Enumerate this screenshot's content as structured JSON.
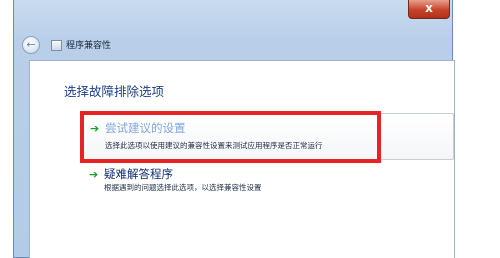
{
  "window": {
    "close_label": "x",
    "title": "程序兼容性"
  },
  "page": {
    "heading": "选择故障排除选项"
  },
  "options": [
    {
      "title": "尝试建议的设置",
      "description": "选择此选项以使用建议的兼容性设置来测试应用程序是否正常运行"
    },
    {
      "title": "疑难解答程序",
      "description": "根据遇到的问题选择此选项，以选择兼容性设置"
    }
  ],
  "colors": {
    "highlight_border": "#e62424",
    "arrow": "#1aa12b",
    "heading_text": "#1e3f8a"
  },
  "icons": {
    "back": "back-arrow-icon",
    "close": "close-icon",
    "app": "app-icon",
    "option_arrow": "green-arrow-icon"
  }
}
